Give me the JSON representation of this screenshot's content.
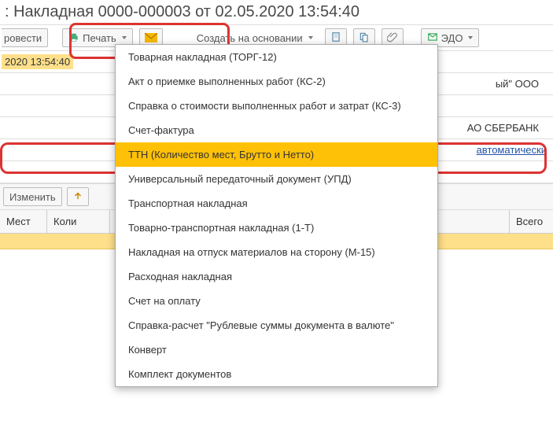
{
  "title": ": Накладная 0000-000003 от 02.05.2020 13:54:40",
  "toolbar": {
    "carryout_partial": "ровести",
    "print": "Печать",
    "create_based": "Создать на основании",
    "edo": "ЭДО"
  },
  "rows": {
    "date_chip": "2020 13:54:40",
    "org_partial": "ый\" ООО",
    "bank_partial": "АО СБЕРБАНК",
    "auto_link": "автоматически"
  },
  "control": {
    "change": "Изменить"
  },
  "cols": {
    "places": "Мест",
    "qty": "Коли",
    "total": "Всего"
  },
  "dropdown": {
    "items": [
      "Товарная накладная (ТОРГ-12)",
      "Акт о приемке выполненных работ (КС-2)",
      "Справка о стоимости выполненных работ и затрат (КС-3)",
      "Счет-фактура",
      "ТТН (Количество мест, Брутто и Нетто)",
      "Универсальный передаточный документ (УПД)",
      "Транспортная накладная",
      "Товарно-транспортная накладная (1-Т)",
      "Накладная на отпуск материалов на сторону (М-15)",
      "Расходная накладная",
      "Счет на оплату",
      "Справка-расчет \"Рублевые суммы документа в валюте\"",
      "Конверт",
      "Комплект документов"
    ],
    "selected_index": 4
  }
}
